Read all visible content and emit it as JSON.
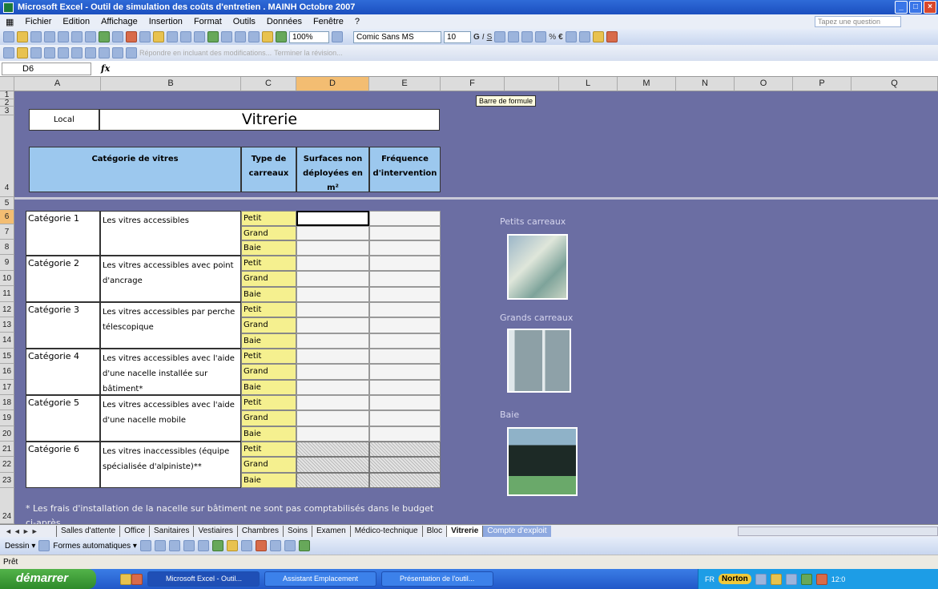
{
  "window": {
    "title": "Microsoft Excel - Outil de simulation des coûts d'entretien . MAINH Octobre 2007"
  },
  "menu": {
    "items": [
      "Fichier",
      "Edition",
      "Affichage",
      "Insertion",
      "Format",
      "Outils",
      "Données",
      "Fenêtre",
      "?"
    ],
    "ask_placeholder": "Tapez une question"
  },
  "toolbar": {
    "zoom": "100%",
    "font": "Comic Sans MS",
    "font_size": "10",
    "review_text": "Répondre en incluant des modifications...",
    "end_review": "Terminer la révision..."
  },
  "formula_bar": {
    "name_box": "D6",
    "fx": "fx",
    "tooltip": "Barre de formule"
  },
  "columns": [
    "A",
    "B",
    "C",
    "D",
    "E",
    "F",
    "Barre de formule",
    "L",
    "M",
    "N",
    "O",
    "P",
    "Q"
  ],
  "rows": [
    "1",
    "2",
    "3",
    "4",
    "5",
    "6",
    "7",
    "8",
    "9",
    "10",
    "11",
    "12",
    "13",
    "14",
    "15",
    "16",
    "17",
    "18",
    "19",
    "20",
    "21",
    "22",
    "23",
    "24"
  ],
  "sheet": {
    "local_label": "Local",
    "title": "Vitrerie",
    "headers": {
      "category": "Catégorie de vitres",
      "type": "Type de carreaux",
      "surface": "Surfaces non déployées en m²",
      "frequency": "Fréquence d'intervention"
    },
    "categories": [
      {
        "name": "Catégorie 1",
        "desc": "Les vitres accessibles"
      },
      {
        "name": "Catégorie 2",
        "desc": "Les vitres accessibles avec point d'ancrage"
      },
      {
        "name": "Catégorie 3",
        "desc": "Les vitres accessibles par perche télescopique"
      },
      {
        "name": "Catégorie 4",
        "desc": "Les vitres accessibles avec l'aide d'une nacelle installée sur bâtiment*"
      },
      {
        "name": "Catégorie 5",
        "desc": "Les vitres accessibles avec l'aide d'une nacelle mobile"
      },
      {
        "name": "Catégorie 6",
        "desc": "Les vitres inaccessibles (équipe spécialisée d'alpiniste)**"
      }
    ],
    "types": [
      "Petit",
      "Grand",
      "Baie"
    ],
    "footnote": "* Les frais d'installation de la nacelle sur bâtiment ne sont pas comptabilisés dans le budget ci-après"
  },
  "side_labels": {
    "small": "Petits carreaux",
    "large": "Grands carreaux",
    "bay": "Baie"
  },
  "tabs": [
    "Salles d'attente",
    "Office",
    "Sanitaires",
    "Vestiaires",
    "Chambres",
    "Soins",
    "Examen",
    "Médico-technique",
    "Bloc",
    "Vitrerie",
    "Compte d'exploit"
  ],
  "active_tab": "Vitrerie",
  "drawbar": {
    "dessin": "Dessin ▾",
    "formes": "Formes automatiques ▾"
  },
  "status": "Prêt",
  "taskbar": {
    "start": "démarrer",
    "tasks": [
      "Microsoft Excel - Outil...",
      "Assistant Emplacement",
      "Présentation de l'outil..."
    ],
    "lang": "FR",
    "norton": "Norton",
    "clock": "12:0"
  }
}
